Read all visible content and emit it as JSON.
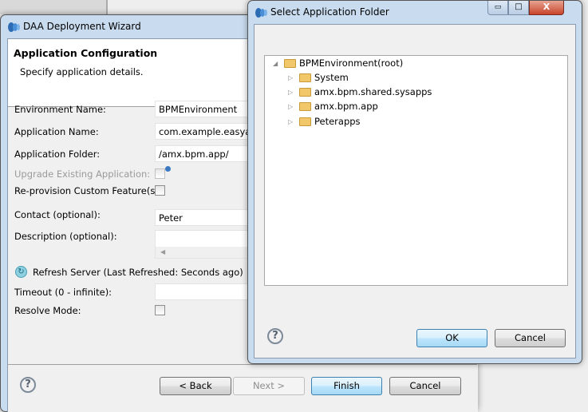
{
  "wizard": {
    "title": "DAA Deployment Wizard",
    "header_title": "Application Configuration",
    "header_subtitle": "Specify application details.",
    "fields": {
      "env_label": "Environment Name:",
      "env_value": "BPMEnvironment",
      "app_label": "Application Name:",
      "app_value": "com.example.easyas",
      "folder_label": "Application Folder:",
      "folder_value": "/amx.bpm.app/",
      "upgrade_label": "Upgrade Existing Application:",
      "reprov_label": "Re-provision Custom Feature(s):",
      "contact_label": "Contact (optional):",
      "contact_value": "Peter",
      "desc_label": "Description (optional):",
      "refresh_label": "Refresh Server (Last Refreshed: Seconds ago)",
      "timeout_label": "Timeout (0 - infinite):",
      "resolve_label": "Resolve Mode:"
    },
    "buttons": {
      "back": "< Back",
      "next": "Next >",
      "finish": "Finish",
      "cancel": "Cancel",
      "help": "?"
    }
  },
  "dialog": {
    "title": "Select Application Folder",
    "tree": {
      "root": "BPMEnvironment(root)",
      "children": [
        "System",
        "amx.bpm.shared.sysapps",
        "amx.bpm.app",
        "Peterapps"
      ]
    },
    "buttons": {
      "ok": "OK",
      "cancel": "Cancel",
      "help": "?"
    },
    "controls": {
      "minimize": "▭",
      "maximize": "□",
      "close": "X"
    }
  }
}
